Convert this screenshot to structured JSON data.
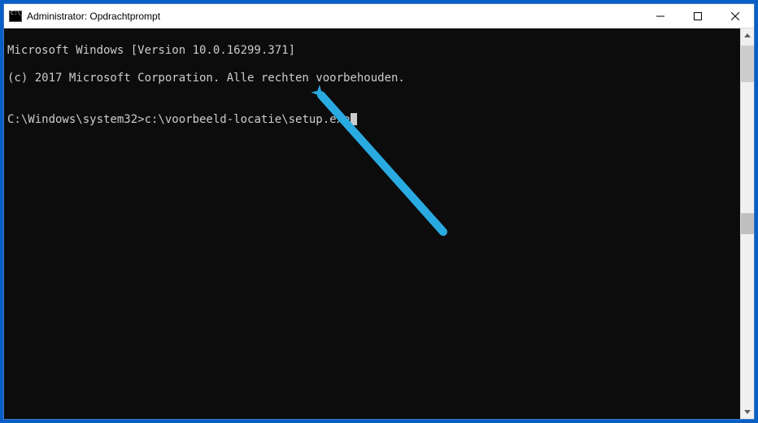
{
  "titlebar": {
    "title": "Administrator: Opdrachtprompt"
  },
  "console": {
    "line1": "Microsoft Windows [Version 10.0.16299.371]",
    "line2": "(c) 2017 Microsoft Corporation. Alle rechten voorbehouden.",
    "blank": "",
    "prompt": "C:\\Windows\\system32>",
    "command": "c:\\voorbeeld-locatie\\setup.exe"
  },
  "arrow": {
    "color": "#29abe2"
  },
  "scrollbar": {
    "thumb_top_pct": 1,
    "thumb_height_pct": 10,
    "lower_thumb_top_pct": 47,
    "lower_thumb_height_pct": 6
  }
}
